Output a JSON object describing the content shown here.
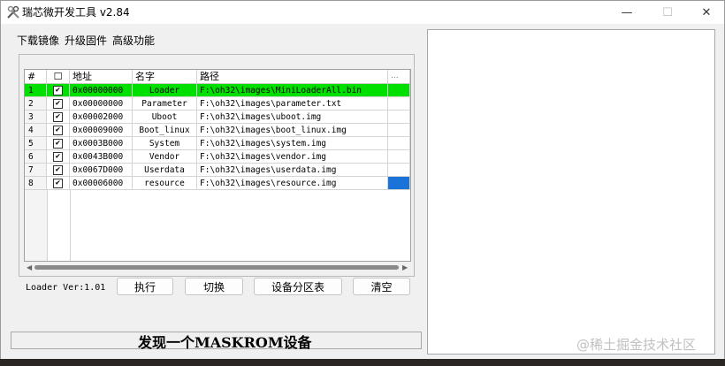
{
  "window": {
    "title": "瑞芯微开发工具 v2.84"
  },
  "controls": {
    "minimize": "—",
    "maximize": "☐",
    "close": "✕"
  },
  "menu": [
    "下载镜像",
    "升级固件",
    "高级功能"
  ],
  "table": {
    "headers": [
      "#",
      "☐",
      "地址",
      "名字",
      "路径",
      "..."
    ],
    "rows": [
      {
        "num": "1",
        "checked": "✔",
        "addr": "0x00000000",
        "name": "Loader",
        "path": "F:\\oh32\\images\\MiniLoaderAll.bin"
      },
      {
        "num": "2",
        "checked": "✔",
        "addr": "0x00000000",
        "name": "Parameter",
        "path": "F:\\oh32\\images\\parameter.txt"
      },
      {
        "num": "3",
        "checked": "✔",
        "addr": "0x00002000",
        "name": "Uboot",
        "path": "F:\\oh32\\images\\uboot.img"
      },
      {
        "num": "4",
        "checked": "✔",
        "addr": "0x00009000",
        "name": "Boot_linux",
        "path": "F:\\oh32\\images\\boot_linux.img"
      },
      {
        "num": "5",
        "checked": "✔",
        "addr": "0x0003B000",
        "name": "System",
        "path": "F:\\oh32\\images\\system.img"
      },
      {
        "num": "6",
        "checked": "✔",
        "addr": "0x0043B000",
        "name": "Vendor",
        "path": "F:\\oh32\\images\\vendor.img"
      },
      {
        "num": "7",
        "checked": "✔",
        "addr": "0x0067D000",
        "name": "Userdata",
        "path": "F:\\oh32\\images\\userdata.img"
      },
      {
        "num": "8",
        "checked": "✔",
        "addr": "0x00006000",
        "name": "resource",
        "path": "F:\\oh32\\images\\resource.img"
      }
    ]
  },
  "scroll": {
    "left": "◀",
    "right": "▶"
  },
  "loader_version": "Loader Ver:1.01",
  "buttons": {
    "execute": "执行",
    "switch": "切换",
    "partition": "设备分区表",
    "clear": "清空"
  },
  "status": "发现一个MASKROM设备",
  "watermark": "@稀土掘金技术社区",
  "colors": {
    "selected_row": "#00e000",
    "selected_cell": "#1a73d9"
  }
}
